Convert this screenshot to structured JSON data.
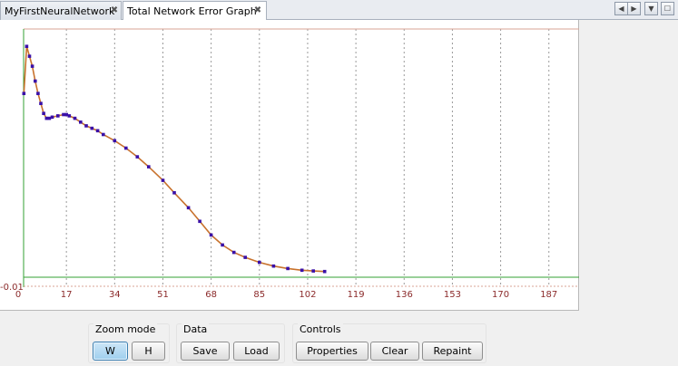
{
  "tabs": [
    {
      "label": "MyFirstNeuralNetwork",
      "active": false
    },
    {
      "label": "Total Network Error Graph",
      "active": true
    }
  ],
  "tab_close_glyph": "✖",
  "nav_buttons": [
    "◀",
    "▶",
    "▼",
    "☐"
  ],
  "chart_data": {
    "type": "line",
    "title": "",
    "xlabel": "",
    "ylabel": "",
    "y_min_label": "-0.01",
    "x_ticks": [
      0,
      17,
      34,
      51,
      68,
      85,
      102,
      119,
      136,
      153,
      170,
      187
    ],
    "xlim": [
      0,
      197
    ],
    "grid": "vertical dotted",
    "series": [
      {
        "color": "#3a10a8",
        "x": [
          2,
          3,
          4,
          5,
          6,
          7,
          8,
          9,
          10,
          11,
          12,
          14,
          16,
          17,
          18,
          20,
          22,
          24,
          26,
          28,
          30,
          34,
          38,
          42,
          46,
          51,
          55,
          60,
          64,
          68,
          72,
          76,
          80,
          85,
          90,
          95,
          100,
          104,
          108
        ],
        "y": [
          0.74,
          0.93,
          0.89,
          0.85,
          0.79,
          0.74,
          0.7,
          0.66,
          0.64,
          0.64,
          0.645,
          0.65,
          0.655,
          0.655,
          0.65,
          0.64,
          0.625,
          0.61,
          0.6,
          0.59,
          0.575,
          0.55,
          0.52,
          0.485,
          0.445,
          0.39,
          0.34,
          0.28,
          0.225,
          0.17,
          0.13,
          0.1,
          0.08,
          0.06,
          0.045,
          0.035,
          0.028,
          0.025,
          0.023
        ]
      }
    ],
    "reference_lines": [
      {
        "color": "#d9a394"
      },
      {
        "color": "#33a033"
      }
    ]
  },
  "controls": {
    "zoom": {
      "title": "Zoom mode",
      "w": "W",
      "h": "H"
    },
    "data": {
      "title": "Data",
      "save": "Save",
      "load": "Load"
    },
    "ctrl": {
      "title": "Controls",
      "properties": "Properties",
      "clear": "Clear",
      "repaint": "Repaint"
    }
  }
}
